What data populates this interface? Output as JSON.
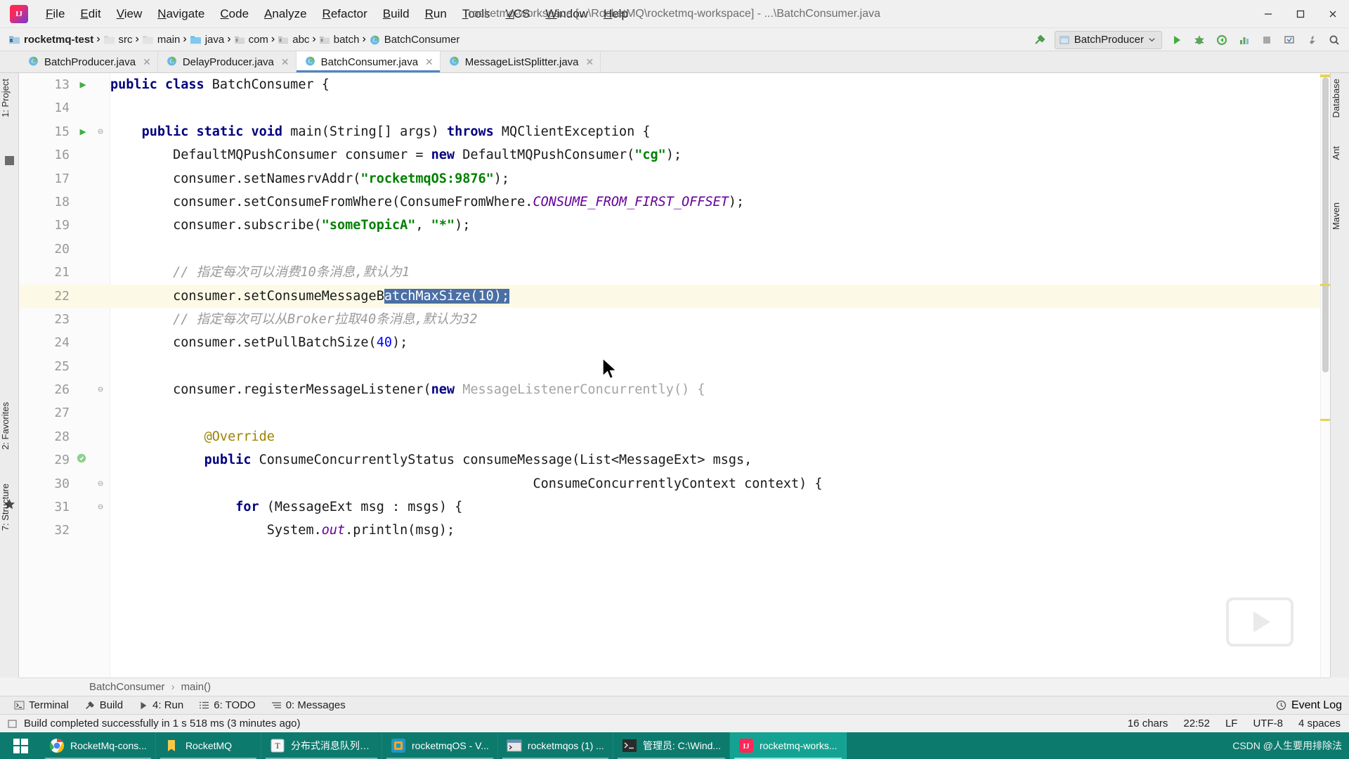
{
  "window": {
    "title": "rocketmq-workspace [...\\RocketMQ\\rocketmq-workspace] - ...\\BatchConsumer.java",
    "minimize": "–",
    "maximize": "❐",
    "close": "✕"
  },
  "menubar": {
    "logo_name": "intellij-idea-logo",
    "items": [
      "File",
      "Edit",
      "View",
      "Navigate",
      "Code",
      "Analyze",
      "Refactor",
      "Build",
      "Run",
      "Tools",
      "VCS",
      "Window",
      "Help"
    ]
  },
  "breadcrumb": {
    "items": [
      {
        "label": "rocketmq-test",
        "icon": "module-icon",
        "bold": true
      },
      {
        "label": "src",
        "icon": "folder-icon",
        "bold": false
      },
      {
        "label": "main",
        "icon": "folder-icon",
        "bold": false
      },
      {
        "label": "java",
        "icon": "source-folder-icon",
        "bold": false
      },
      {
        "label": "com",
        "icon": "package-icon",
        "bold": false
      },
      {
        "label": "abc",
        "icon": "package-icon",
        "bold": false
      },
      {
        "label": "batch",
        "icon": "package-icon",
        "bold": false
      },
      {
        "label": "BatchConsumer",
        "icon": "java-class-icon",
        "bold": false
      }
    ],
    "separator": "›"
  },
  "toolbar": {
    "build_icon": "hammer-build-icon",
    "run_config": "BatchProducer",
    "run_config_icon": "application-config-icon",
    "dropdown_icon": "chevron-down-icon",
    "buttons": [
      {
        "name": "run-button",
        "icon": "play-icon"
      },
      {
        "name": "debug-button",
        "icon": "bug-icon"
      },
      {
        "name": "run-with-coverage-button",
        "icon": "coverage-icon"
      },
      {
        "name": "profile-button",
        "icon": "profiler-icon"
      },
      {
        "name": "stop-button",
        "icon": "stop-icon"
      },
      {
        "name": "update-app-button",
        "icon": "refresh-app-icon"
      },
      {
        "name": "open-ide-settings-button",
        "icon": "wrench-icon"
      },
      {
        "name": "search-everywhere-button",
        "icon": "search-icon"
      }
    ]
  },
  "editor_tabs": [
    {
      "label": "BatchProducer.java",
      "icon": "java-class-icon",
      "active": false,
      "close": "✕"
    },
    {
      "label": "DelayProducer.java",
      "icon": "java-class-icon",
      "active": false,
      "close": "✕"
    },
    {
      "label": "BatchConsumer.java",
      "icon": "java-class-icon",
      "active": true,
      "close": "✕"
    },
    {
      "label": "MessageListSplitter.java",
      "icon": "java-class-icon",
      "active": false,
      "close": "✕"
    }
  ],
  "left_tool_buttons": [
    {
      "label": "1: Project",
      "name": "tool-button-project"
    },
    {
      "label": "2: Favorites",
      "name": "tool-button-favorites"
    },
    {
      "label": "7: Structure",
      "name": "tool-button-structure"
    }
  ],
  "right_tool_buttons": [
    {
      "label": "Database",
      "name": "tool-button-database"
    },
    {
      "label": "Ant",
      "name": "tool-button-ant"
    },
    {
      "label": "Maven",
      "name": "tool-button-maven"
    }
  ],
  "code": {
    "first_line_number": 13,
    "lines": [
      {
        "n": 13,
        "run": true,
        "fold": false,
        "text_html": "<span class=\"kw\">public class </span>BatchConsumer {"
      },
      {
        "n": 14,
        "run": false,
        "fold": false,
        "text_html": ""
      },
      {
        "n": 15,
        "run": true,
        "fold": true,
        "text_html": "    <span class=\"kw\">public static void </span>main(String[] args) <span class=\"kw\">throws </span>MQClientException {"
      },
      {
        "n": 16,
        "run": false,
        "fold": false,
        "text_html": "        DefaultMQPushConsumer consumer = <span class=\"kw\">new </span>DefaultMQPushConsumer(<span class=\"str\">\"cg\"</span>);"
      },
      {
        "n": 17,
        "run": false,
        "fold": false,
        "text_html": "        consumer.setNamesrvAddr(<span class=\"str\">\"rocketmqOS:9876\"</span>);"
      },
      {
        "n": 18,
        "run": false,
        "fold": false,
        "text_html": "        consumer.setConsumeFromWhere(ConsumeFromWhere.<span class=\"sfield\">CONSUME_FROM_FIRST_OFFSET</span>);"
      },
      {
        "n": 19,
        "run": false,
        "fold": false,
        "text_html": "        consumer.subscribe(<span class=\"str\">\"someTopicA\"</span>, <span class=\"str\">\"*\"</span>);"
      },
      {
        "n": 20,
        "run": false,
        "fold": false,
        "text_html": ""
      },
      {
        "n": 21,
        "run": false,
        "fold": false,
        "text_html": "        <span class=\"cmt\">// 指定每次可以消费10条消息,默认为1</span>"
      },
      {
        "n": 22,
        "run": false,
        "fold": false,
        "highlight": true,
        "text_html": "        consumer.setConsumeMessageB<span class=\"sel\">atchMaxSize(10);</span>"
      },
      {
        "n": 23,
        "run": false,
        "fold": false,
        "text_html": "        <span class=\"cmt\">// 指定每次可以从Broker拉取40条消息,默认为32</span>"
      },
      {
        "n": 24,
        "run": false,
        "fold": false,
        "text_html": "        consumer.setPullBatchSize(<span class=\"num\">40</span>);"
      },
      {
        "n": 25,
        "run": false,
        "fold": false,
        "text_html": ""
      },
      {
        "n": 26,
        "run": false,
        "fold": true,
        "text_html": "        consumer.registerMessageListener(<span class=\"kw\">new </span><span class=\"gray\">MessageListenerConcurrently() {</span>"
      },
      {
        "n": 27,
        "run": false,
        "fold": false,
        "text_html": ""
      },
      {
        "n": 28,
        "run": false,
        "fold": false,
        "text_html": "            <span class=\"anno\">@Override</span>"
      },
      {
        "n": 29,
        "run": false,
        "fold": false,
        "warn": true,
        "text_html": "            <span class=\"kw\">public </span>ConsumeConcurrentlyStatus consumeMessage(List&lt;MessageExt&gt; msgs,"
      },
      {
        "n": 30,
        "run": false,
        "fold": true,
        "text_html": "                                                      ConsumeConcurrentlyContext context) {"
      },
      {
        "n": 31,
        "run": false,
        "fold": true,
        "text_html": "                <span class=\"kw\">for </span>(MessageExt msg : msgs) {"
      },
      {
        "n": 32,
        "run": false,
        "fold": false,
        "text_html": "                    System.<span class=\"sfield\">out</span>.println(msg);"
      }
    ]
  },
  "editor_breadcrumb": {
    "items": [
      "BatchConsumer",
      "main()"
    ],
    "separator": "›"
  },
  "tool_window_bar": {
    "buttons": [
      {
        "label": "Terminal",
        "icon": "terminal-icon",
        "mnemonic": ""
      },
      {
        "label": "Build",
        "icon": "hammer-build-icon",
        "mnemonic": ""
      },
      {
        "label": "4: Run",
        "icon": "play-icon",
        "mnemonic": "4"
      },
      {
        "label": "6: TODO",
        "icon": "list-icon",
        "mnemonic": "6"
      },
      {
        "label": "0: Messages",
        "icon": "messages-icon",
        "mnemonic": "0"
      }
    ],
    "event_log": {
      "label": "Event Log",
      "icon": "event-log-icon"
    }
  },
  "statusbar": {
    "message": "Build completed successfully in 1 s 518 ms (3 minutes ago)",
    "message_icon": "build-status-icon",
    "selection": "16 chars",
    "caret": "22:52",
    "line_separator": "LF",
    "encoding": "UTF-8",
    "indent": "4 spaces"
  },
  "taskbar": {
    "start_icon": "windows-start-icon",
    "items": [
      {
        "label": "RocketMq-cons...",
        "icon": "chrome-icon",
        "active": false
      },
      {
        "label": "RocketMQ",
        "icon": "folder-icon",
        "active": false
      },
      {
        "label": "分布式消息队列R...",
        "icon": "typora-icon",
        "active": false
      },
      {
        "label": "rocketmqOS - V...",
        "icon": "vmware-icon",
        "active": false
      },
      {
        "label": "rocketmqos (1) ...",
        "icon": "xshell-icon",
        "active": false
      },
      {
        "label": "管理员: C:\\Wind...",
        "icon": "cmd-icon",
        "active": false
      },
      {
        "label": "rocketmq-works...",
        "icon": "intellij-icon",
        "active": true
      }
    ],
    "tray_icons": [
      "network-icon",
      "volume-icon",
      "ime-icon"
    ],
    "watermark": "CSDN @人生要用排除法"
  },
  "colors": {
    "accent": "#4a86c8",
    "selection": "#4a6fa5",
    "highlight_line": "#fcfae6",
    "taskbar": "#0d7a6e",
    "taskbar_active": "#14a392",
    "keyword": "#000080",
    "string": "#008000",
    "comment": "#9a9a9a",
    "static_field": "#660099",
    "number": "#0000ff"
  }
}
